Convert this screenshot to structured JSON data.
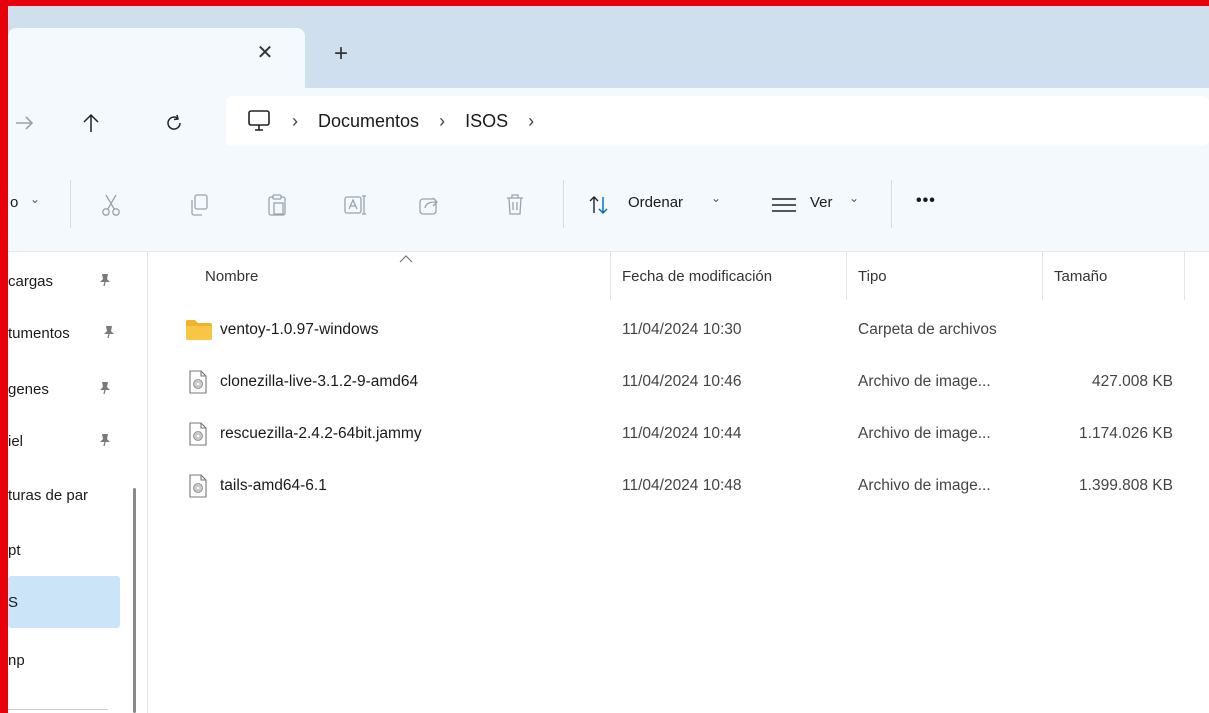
{
  "tab": {
    "close_glyph": "✕",
    "new_glyph": "+"
  },
  "breadcrumb": {
    "items": [
      "Documentos",
      "ISOS"
    ],
    "sep": "›"
  },
  "toolbar": {
    "new_partial": "o",
    "sort_label": "Ordenar",
    "view_label": "Ver",
    "more_label": "•••",
    "chevron": "⌄"
  },
  "sidebar": {
    "items": [
      {
        "label": "cargas",
        "pinned": true
      },
      {
        "label": "tumentos",
        "pinned": true
      },
      {
        "label": "genes",
        "pinned": true
      },
      {
        "label": "iel",
        "pinned": true
      },
      {
        "label": "turas de par",
        "pinned": false
      },
      {
        "label": "pt",
        "pinned": false
      },
      {
        "label": "S",
        "pinned": false,
        "selected": true
      },
      {
        "label": "np",
        "pinned": false
      }
    ]
  },
  "columns": {
    "name": "Nombre",
    "date": "Fecha de modificación",
    "type": "Tipo",
    "size": "Tamaño"
  },
  "files": [
    {
      "name": "ventoy-1.0.97-windows",
      "date": "11/04/2024 10:30",
      "type": "Carpeta de archivos",
      "size": "",
      "icon": "folder-icon"
    },
    {
      "name": "clonezilla-live-3.1.2-9-amd64",
      "date": "11/04/2024 10:46",
      "type": "Archivo de image...",
      "size": "427.008 KB",
      "icon": "disc-image-icon"
    },
    {
      "name": "rescuezilla-2.4.2-64bit.jammy",
      "date": "11/04/2024 10:44",
      "type": "Archivo de image...",
      "size": "1.174.026 KB",
      "icon": "disc-image-icon"
    },
    {
      "name": "tails-amd64-6.1",
      "date": "11/04/2024 10:48",
      "type": "Archivo de image...",
      "size": "1.399.808 KB",
      "icon": "disc-image-icon"
    }
  ],
  "colors": {
    "accent_frame": "#e8000b",
    "selected_bg": "#cce4f7",
    "folder": "#f0b429",
    "tabstrip": "#cfdfee"
  }
}
